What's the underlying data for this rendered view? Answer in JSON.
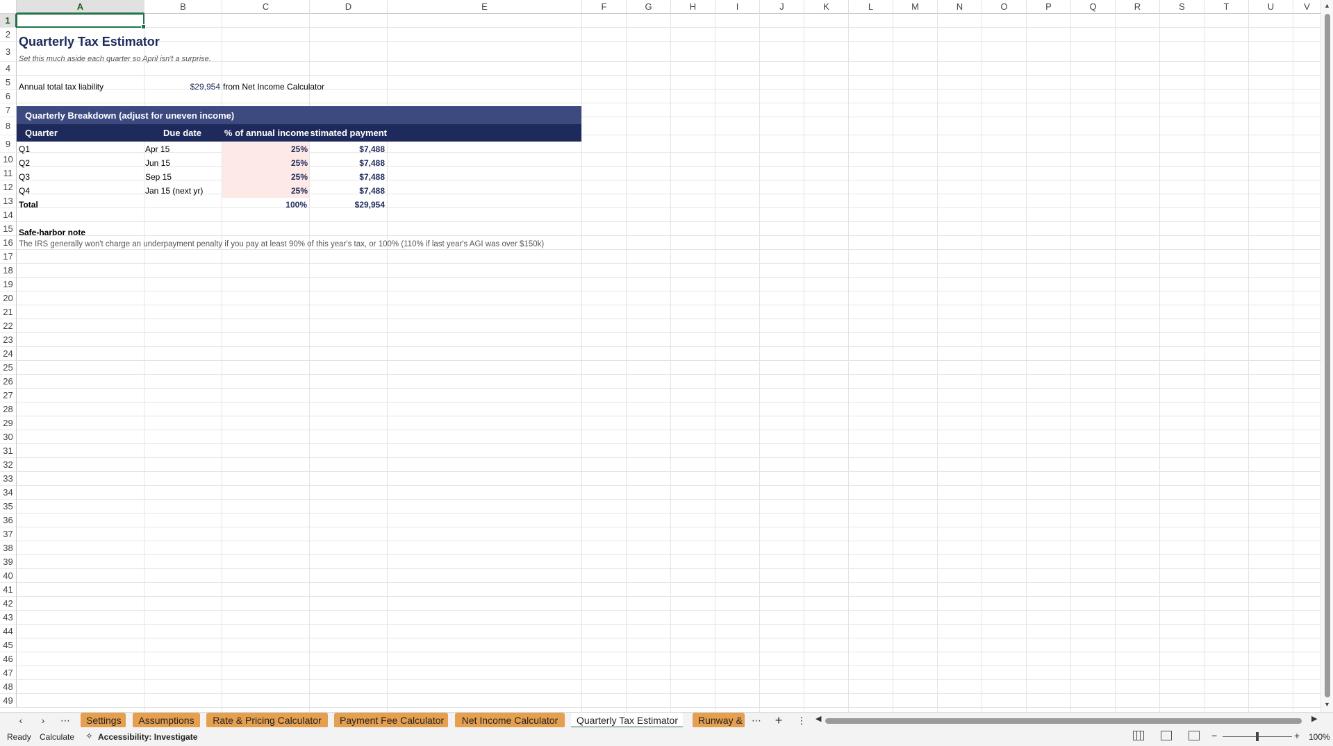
{
  "columns": [
    "A",
    "B",
    "C",
    "D",
    "E",
    "F",
    "G",
    "H",
    "I",
    "J",
    "K",
    "L",
    "M",
    "N",
    "O",
    "P",
    "Q",
    "R",
    "S",
    "T",
    "U",
    "V"
  ],
  "rows": [
    "1",
    "2",
    "3",
    "4",
    "5",
    "6",
    "7",
    "8",
    "9",
    "10",
    "11",
    "12",
    "13",
    "14",
    "15",
    "16",
    "17",
    "18",
    "19",
    "20",
    "21",
    "22",
    "23",
    "24",
    "25",
    "26",
    "27",
    "28",
    "29",
    "30",
    "31",
    "32",
    "33",
    "34",
    "35",
    "36",
    "37",
    "38",
    "39",
    "40",
    "41",
    "42",
    "43",
    "44",
    "45",
    "46",
    "47",
    "48",
    "49"
  ],
  "selected_cell": "A1",
  "sheet": {
    "title": "Quarterly Tax Estimator",
    "subtitle": "Set this much aside each quarter so April isn't a surprise.",
    "liability_label": "Annual total tax liability",
    "liability_value": "$29,954",
    "liability_source": "from Net Income Calculator",
    "breakdown_header": "Quarterly Breakdown (adjust for uneven income)",
    "table_headers": [
      "Quarter",
      "Due date",
      "% of annual income",
      "Estimated payment"
    ],
    "quarters": [
      {
        "quarter": "Q1",
        "due": "Apr 15",
        "pct": "25%",
        "payment": "$7,488"
      },
      {
        "quarter": "Q2",
        "due": "Jun 15",
        "pct": "25%",
        "payment": "$7,488"
      },
      {
        "quarter": "Q3",
        "due": "Sep 15",
        "pct": "25%",
        "payment": "$7,488"
      },
      {
        "quarter": "Q4",
        "due": "Jan 15 (next yr)",
        "pct": "25%",
        "payment": "$7,488"
      }
    ],
    "total_label": "Total",
    "total_pct": "100%",
    "total_payment": "$29,954",
    "note_title": "Safe-harbor note",
    "note_text": "The IRS generally won't charge an underpayment penalty if you pay at least 90% of this year's tax, or 100% (110% if last year's AGI was over $150k)"
  },
  "tabs": [
    {
      "label": "Settings",
      "active": false
    },
    {
      "label": "Assumptions",
      "active": false
    },
    {
      "label": "Rate & Pricing Calculator",
      "active": false
    },
    {
      "label": "Payment Fee Calculator",
      "active": false
    },
    {
      "label": "Net Income Calculator",
      "active": false
    },
    {
      "label": "Quarterly Tax Estimator",
      "active": true
    },
    {
      "label": "Runway &",
      "active": false
    }
  ],
  "status": {
    "ready": "Ready",
    "calculate": "Calculate",
    "accessibility": "Accessibility: Investigate",
    "zoom": "100%"
  },
  "colors": {
    "title": "#1f2a5c",
    "header_band": "#3d4a80",
    "header_row": "#1f2a5c",
    "pct_fill": "#fde9e6",
    "tab": "#e59f4f",
    "selection": "#217346"
  }
}
